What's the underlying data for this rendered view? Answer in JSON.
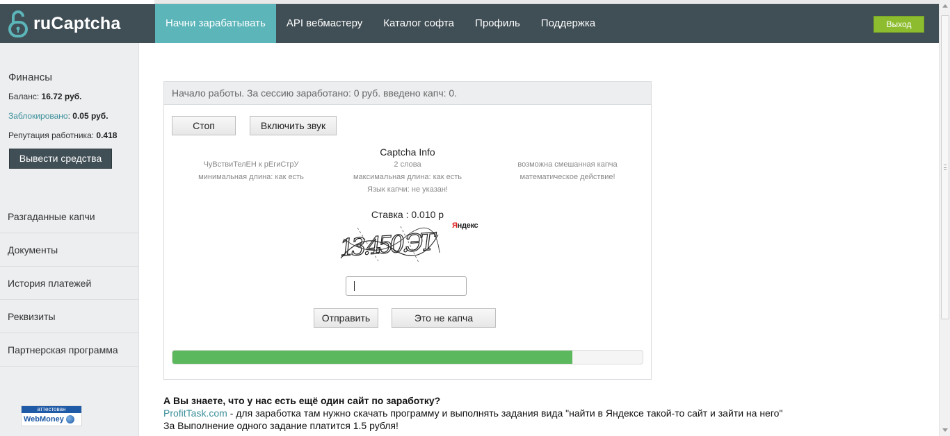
{
  "brand": {
    "name": "ruCaptcha",
    "icon": "open-padlock-icon",
    "accent": "#5bb5b9"
  },
  "nav": {
    "items": [
      {
        "label": "Начни зарабатывать",
        "active": true
      },
      {
        "label": "API вебмастеру"
      },
      {
        "label": "Каталог софта"
      },
      {
        "label": "Профиль"
      },
      {
        "label": "Поддержка"
      }
    ],
    "logout_label": "Выход"
  },
  "finance": {
    "title": "Финансы",
    "balance_label": "Баланс:",
    "balance_value": "16.72 руб.",
    "blocked_label": "Заблокировано",
    "blocked_value": "0.05 руб.",
    "reputation_label": "Репутация работника:",
    "reputation_value": "0.418",
    "withdraw_label": "Вывести средства"
  },
  "sidebar_menu": [
    "Разгаданные капчи",
    "Документы",
    "История платежей",
    "Реквизиты",
    "Партнерская программа"
  ],
  "badge": {
    "top": "аттестован",
    "bottom": "WebMoney",
    "icon": "webmoney-globe-icon"
  },
  "work": {
    "status": "Начало работы. За сессию заработано: 0 руб. введено капч: 0.",
    "stop_label": "Стоп",
    "sound_label": "Включить звук",
    "info_title": "Captcha Info",
    "hints_left": [
      "ЧуВствиТелЕН к рЕгиСтрУ",
      "минимальная длина: как есть"
    ],
    "hints_center": [
      "2 слова",
      "максимальная длина: как есть",
      "Язык капчи: не указан!"
    ],
    "hints_right": [
      "возможна смешанная капча",
      "математическое действие!"
    ],
    "rate": "Ставка : 0.010 р",
    "captcha_text": "13.450.ЭТ",
    "yandex_first": "Я",
    "yandex_rest": "ндекс",
    "answer_value": "",
    "submit_label": "Отправить",
    "not_captcha_label": "Это не капча",
    "progress_percent": 85,
    "progress_color": "#5cb85c"
  },
  "promo": {
    "title": "А Вы знаете, что у нас есть ещё один сайт по заработку?",
    "link": "ProfitTask.com",
    "text": " - для заработка там нужно скачать программу и выполнять задания вида \"найти в Яндексе такой-то сайт и зайти на него\"",
    "text2": "За Выполнение одного задание платится 1.5 рубля!"
  }
}
